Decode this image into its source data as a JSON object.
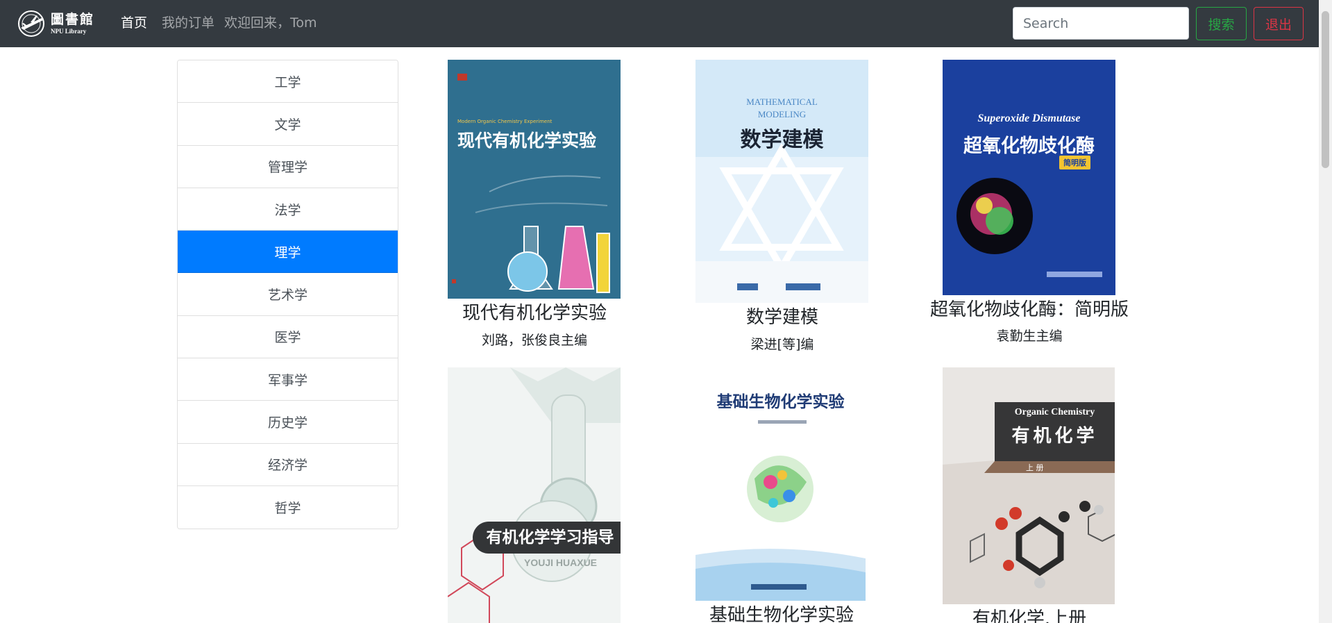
{
  "header": {
    "logo": {
      "cn": "圖書館",
      "en": "NPU Library"
    },
    "nav": {
      "home": "首页",
      "orders": "我的订单",
      "welcome": "欢迎回来，Tom"
    },
    "search": {
      "placeholder": "Search",
      "button_label": "搜索"
    },
    "logout_label": "退出"
  },
  "sidebar": {
    "selected": "理学",
    "items": [
      {
        "label": "工学"
      },
      {
        "label": "文学"
      },
      {
        "label": "管理学"
      },
      {
        "label": "法学"
      },
      {
        "label": "理学"
      },
      {
        "label": "艺术学"
      },
      {
        "label": "医学"
      },
      {
        "label": "军事学"
      },
      {
        "label": "历史学"
      },
      {
        "label": "经济学"
      },
      {
        "label": "哲学"
      }
    ]
  },
  "books": [
    {
      "title": "现代有机化学实验",
      "author": "刘路，张俊良主编",
      "cover": {
        "subtitle": "Modern Organic Chemistry Experiment",
        "heading": "现代有机化学实验",
        "color": "#2e6e8e"
      }
    },
    {
      "title": "数学建模",
      "author": "梁进[等]编",
      "cover": {
        "subtitle": "MATHEMATICAL MODELING",
        "heading": "数学建模",
        "color": "#d3e8f7"
      }
    },
    {
      "title": "超氧化物歧化酶：简明版",
      "author": "袁勤生主编",
      "cover": {
        "subtitle": "Superoxide Dismutase",
        "heading": "超氧化物歧化酶",
        "badge": "简明版",
        "color": "#1a3f9c"
      }
    },
    {
      "title": "",
      "author": "",
      "cover": {
        "subtitle": "YOUJI HUAXUE",
        "heading": "有机化学学习指导",
        "color": "#eef2f1"
      }
    },
    {
      "title": "基础生物化学实验",
      "author": "",
      "cover": {
        "subtitle": "",
        "heading": "基础生物化学实验",
        "color": "#ffffff"
      }
    },
    {
      "title": "有机化学.上册",
      "author": "",
      "cover": {
        "subtitle": "Organic Chemistry",
        "heading": "有机化学",
        "badge": "上 册",
        "color": "#cfc6c0"
      }
    }
  ],
  "theme": {
    "navbar": "#343a40",
    "primary": "#007bff",
    "success": "#28a745",
    "danger": "#dc3545"
  }
}
